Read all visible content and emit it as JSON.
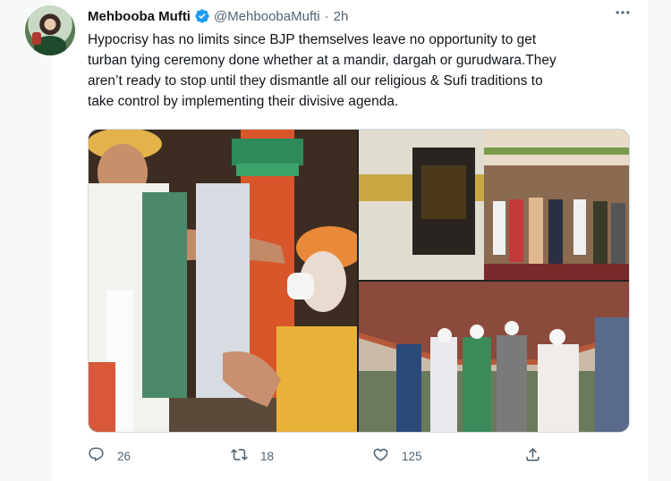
{
  "tweet": {
    "author_name": "Mehbooba Mufti",
    "handle": "@MehboobaMufti",
    "separator": "·",
    "time": "2h",
    "more_icon": "ellipsis-icon",
    "verified_color": "#1d9bf0",
    "text_lines": [
      "Hypocrisy has no limits since BJP themselves leave no opportunity to get",
      "turban tying ceremony done whether at a mandir, dargah or gurudwara.They",
      "aren’t ready to stop until they dismantle all our religious &  Sufi traditions to",
      "take control by implementing their divisive agenda."
    ],
    "media": [
      {
        "name": "turban-tying-photo"
      },
      {
        "name": "dargah-visit-photo"
      },
      {
        "name": "gurudwara-visit-photo"
      }
    ]
  },
  "actions": {
    "reply_count": "26",
    "retweet_count": "18",
    "like_count": "125",
    "icons": [
      "reply-icon",
      "retweet-icon",
      "like-icon",
      "share-icon"
    ]
  }
}
